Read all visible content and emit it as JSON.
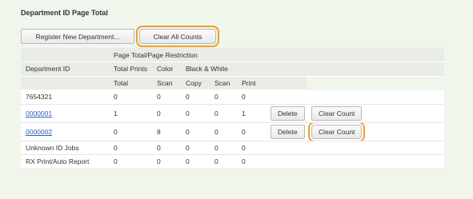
{
  "panel": {
    "title": "Department ID Page Total"
  },
  "toolbar": {
    "register_label": "Register New Department...",
    "clear_all_label": "Clear All Counts"
  },
  "table": {
    "headers": {
      "department_id": "Department ID",
      "page_total_restriction": "Page Total/Page Restriction",
      "total_prints": "Total Prints",
      "color": "Color",
      "black_white": "Black & White",
      "total": "Total",
      "scan": "Scan",
      "copy": "Copy",
      "scan_bw": "Scan",
      "print": "Print"
    },
    "rows": [
      {
        "id": "7654321",
        "total": "0",
        "color_scan": "0",
        "copy": "0",
        "scan": "0",
        "print": "0"
      },
      {
        "id": "0000001",
        "total": "1",
        "color_scan": "0",
        "copy": "0",
        "scan": "0",
        "print": "1",
        "delete_label": "Delete",
        "clear_label": "Clear Count"
      },
      {
        "id": "0000002",
        "total": "0",
        "color_scan": "8",
        "copy": "0",
        "scan": "0",
        "print": "0",
        "delete_label": "Delete",
        "clear_label": "Clear Count"
      },
      {
        "id": "Unknown ID Jobs",
        "total": "0",
        "color_scan": "0",
        "copy": "0",
        "scan": "0",
        "print": "0"
      },
      {
        "id": "RX Print/Auto Report",
        "total": "0",
        "color_scan": "0",
        "copy": "0",
        "scan": "0",
        "print": "0"
      }
    ]
  },
  "colors": {
    "background": "#f1f6ec",
    "highlight": "#f0a020",
    "link": "#2f62b5"
  }
}
